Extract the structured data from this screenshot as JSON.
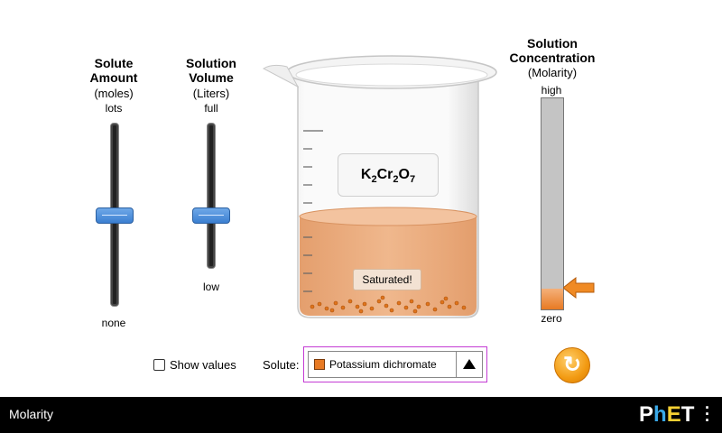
{
  "solute_slider": {
    "title_line1": "Solute",
    "title_line2": "Amount",
    "unit": "(moles)",
    "max_label": "lots",
    "min_label": "none",
    "value_fraction": 0.5
  },
  "volume_slider": {
    "title_line1": "Solution",
    "title_line2": "Volume",
    "unit": "(Liters)",
    "max_label": "full",
    "min_label": "low",
    "value_fraction": 0.5
  },
  "beaker": {
    "formula_parts": [
      "K",
      "2",
      "Cr",
      "2",
      "O",
      "7"
    ],
    "status_text": "Saturated!",
    "solution_color": "#e8a070"
  },
  "concentration_meter": {
    "title_line1": "Solution",
    "title_line2": "Concentration",
    "unit": "(Molarity)",
    "max_label": "high",
    "min_label": "zero",
    "level_fraction": 0.1,
    "fill_color": "#e87a23",
    "arrow_color": "#e87a23"
  },
  "controls": {
    "show_values_label": "Show values",
    "show_values_checked": false,
    "solute_label": "Solute:",
    "solute_selected": "Potassium dichromate",
    "solute_swatch_color": "#e87a23",
    "reset_icon": "reset-all-icon"
  },
  "navbar": {
    "sim_title": "Molarity",
    "logo_text": "PhET"
  }
}
